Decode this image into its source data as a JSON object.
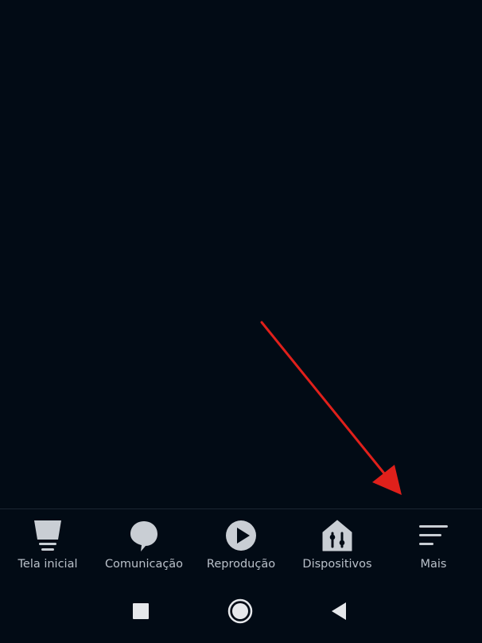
{
  "bottom_nav": {
    "items": [
      {
        "label": "Tela inicial",
        "icon": "home-screen-icon"
      },
      {
        "label": "Comunicação",
        "icon": "chat-bubble-icon"
      },
      {
        "label": "Reprodução",
        "icon": "play-icon"
      },
      {
        "label": "Dispositivos",
        "icon": "smart-home-devices-icon"
      },
      {
        "label": "Mais",
        "icon": "menu-lines-icon"
      }
    ]
  },
  "system_nav": {
    "buttons": [
      "recent-apps",
      "home",
      "back"
    ]
  },
  "colors": {
    "background": "#020b15",
    "icon": "#c9ced4",
    "label": "#b9c0c9",
    "annotation_arrow": "#e0201b"
  }
}
